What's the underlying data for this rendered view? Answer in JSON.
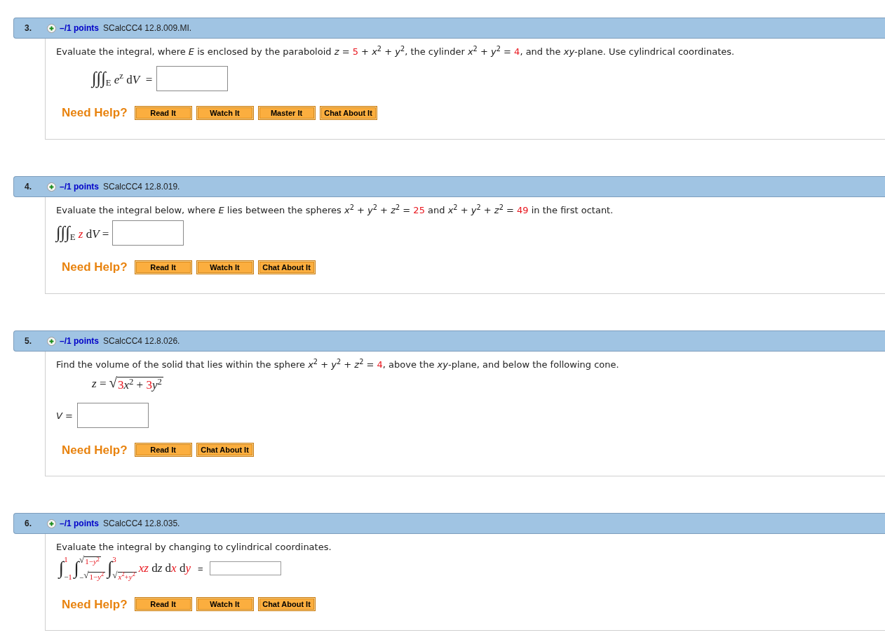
{
  "questions": [
    {
      "number": "3.",
      "points": "–/1 points",
      "code": "SCalcCC4 12.8.009.MI.",
      "rows": [
        {
          "kind": "paragraph",
          "segments": [
            {
              "kind": "text",
              "text": "Evaluate the integral, where *E* is enclosed by the paraboloid *z* = "
            },
            {
              "kind": "value",
              "text": "5"
            },
            {
              "kind": "text",
              "text": " + *x*$^{2}$ + *y*$^{2}$, the cylinder *x*$^{2}$ + *y*$^{2}$ = "
            },
            {
              "kind": "value",
              "text": "4"
            },
            {
              "kind": "text",
              "text": ", and the *xy*-plane. Use cylindrical coordinates."
            }
          ]
        },
        {
          "kind": "display_math_answer",
          "segments": [
            {
              "kind": "big",
              "text": "∫∫∫"
            },
            {
              "kind": "text",
              "text": "$_{E}$ *e*$^{z}$ d"
            },
            {
              "kind": "text",
              "text": "*V*  ="
            }
          ]
        }
      ],
      "help": {
        "label": "Need Help?",
        "buttons": [
          "Read It",
          "Watch It",
          "Master It",
          "Chat About It"
        ]
      }
    },
    {
      "number": "4.",
      "points": "–/1 points",
      "code": "SCalcCC4 12.8.019.",
      "rows": [
        {
          "kind": "paragraph",
          "segments": [
            {
              "kind": "text",
              "text": "Evaluate the integral below, where *E* lies between the spheres *x*$^{2}$ + *y*$^{2}$ + *z*$^{2}$ = "
            },
            {
              "kind": "value",
              "text": "25"
            },
            {
              "kind": "text",
              "text": " and *x*$^{2}$ + *y*$^{2}$ + *z*$^{2}$ = "
            },
            {
              "kind": "value",
              "text": "49"
            },
            {
              "kind": "text",
              "text": " in the first octant."
            }
          ]
        },
        {
          "kind": "math_answer",
          "segments": [
            {
              "kind": "big",
              "text": "∫∫∫"
            },
            {
              "kind": "text",
              "text": "$_{E}$ "
            },
            {
              "kind": "value",
              "text": "*z*"
            },
            {
              "kind": "text",
              "text": " d"
            },
            {
              "kind": "text",
              "text": "*V* ="
            }
          ]
        }
      ],
      "help": {
        "label": "Need Help?",
        "buttons": [
          "Read It",
          "Watch It",
          "Chat About It"
        ]
      }
    },
    {
      "number": "5.",
      "points": "–/1 points",
      "code": "SCalcCC4 12.8.026.",
      "rows": [
        {
          "kind": "paragraph",
          "segments": [
            {
              "kind": "text",
              "text": "Find the volume of the solid that lies within the sphere *x*$^{2}$ + *y*$^{2}$ + *z*$^{2}$ = "
            },
            {
              "kind": "value",
              "text": "4"
            },
            {
              "kind": "text",
              "text": ", above the *xy*-plane, and below the following cone."
            }
          ]
        },
        {
          "kind": "display_math",
          "segments": [
            {
              "kind": "text",
              "text": "*z* = "
            },
            {
              "kind": "sqrt",
              "sign": "√",
              "radicand": [
                {
                  "kind": "value",
                  "text": "3"
                },
                {
                  "kind": "text",
                  "text": "*x*$^{2}$ + "
                },
                {
                  "kind": "value",
                  "text": "3"
                },
                {
                  "kind": "text",
                  "text": "*y*$^{2}$"
                }
              ]
            }
          ]
        },
        {
          "kind": "label_answer",
          "label": "*V* ="
        }
      ],
      "help": {
        "label": "Need Help?",
        "buttons": [
          "Read It",
          "Chat About It"
        ]
      }
    },
    {
      "number": "6.",
      "points": "–/1 points",
      "code": "SCalcCC4 12.8.035.",
      "rows": [
        {
          "kind": "paragraph",
          "segments": [
            {
              "kind": "text",
              "text": "Evaluate the integral by changing to cylindrical coordinates."
            }
          ]
        },
        {
          "kind": "integral_answer",
          "integrals": [
            {
              "sign": "∫",
              "upper": [
                {
                  "kind": "value",
                  "text": "1"
                }
              ],
              "lower": [
                {
                  "kind": "text",
                  "text": "−"
                },
                {
                  "kind": "value",
                  "text": "1"
                }
              ]
            },
            {
              "sign": "∫",
              "upper": [
                {
                  "kind": "sqrt",
                  "sign": "√",
                  "radicand": [
                    {
                      "kind": "value",
                      "text": "1−*y*$^{2}$"
                    }
                  ]
                }
              ],
              "lower": [
                {
                  "kind": "text",
                  "text": "−"
                },
                {
                  "kind": "sqrt",
                  "sign": "√",
                  "radicand": [
                    {
                      "kind": "value",
                      "text": "1−*y*$^{2}$"
                    }
                  ]
                }
              ]
            },
            {
              "sign": "∫",
              "upper": [
                {
                  "kind": "value",
                  "text": "3"
                }
              ],
              "lower": [
                {
                  "kind": "sqrt",
                  "sign": "√",
                  "radicand": [
                    {
                      "kind": "value",
                      "text": "*x*$^{2}$+*y*$^{2}$"
                    }
                  ]
                }
              ]
            }
          ],
          "integrand": [
            {
              "kind": "value",
              "text": "*xz*"
            },
            {
              "kind": "text",
              "text": " d"
            },
            {
              "kind": "text",
              "text": "*z* d"
            },
            {
              "kind": "value",
              "text": "*x*"
            },
            {
              "kind": "text",
              "text": " d"
            },
            {
              "kind": "value",
              "text": "*y*"
            }
          ],
          "equals": "="
        }
      ],
      "help": {
        "label": "Need Help?",
        "buttons": [
          "Read It",
          "Watch It",
          "Chat About It"
        ]
      }
    }
  ]
}
